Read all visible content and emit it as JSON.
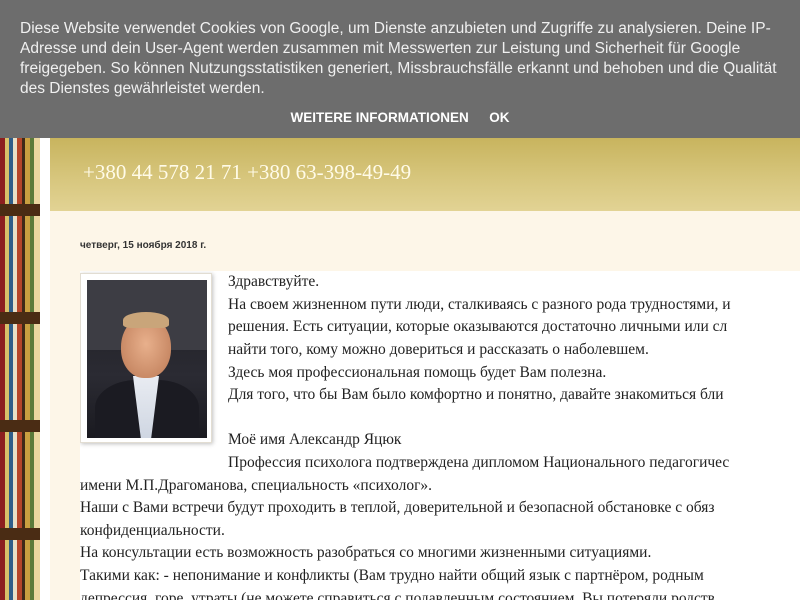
{
  "cookie_banner": {
    "message": "Diese Website verwendet Cookies von Google, um Dienste anzubieten und Zugriffe zu analysieren. Deine IP-Adresse und dein User-Agent werden zusammen mit Messwerten zur Leistung und Sicherheit für Google freigegeben. So können Nutzungsstatistiken generiert, Missbrauchsfälle erkannt und behoben und die Qualität des Dienstes gewährleistet werden.",
    "more_info_label": "WEITERE INFORMATIONEN",
    "ok_label": "OK"
  },
  "header": {
    "phone": "+380 44 578 21 71 +380 63-398-49-49"
  },
  "post": {
    "date": "четверг, 15 ноября 2018 г.",
    "lines": [
      "Здравствуйте.",
      "На своем жизненном пути люди, сталкиваясь с разного рода трудностями, и",
      "решения. Есть ситуации, которые оказываются достаточно личными или сл",
      "найти того, кому можно довериться и рассказать о наболевшем.",
      "Здесь моя профессиональная помощь будет Вам полезна.",
      "Для того, что бы Вам было комфортно и понятно, давайте знакомиться бли",
      "",
      "Моё имя Александр Яцюк",
      "Профессия психолога подтверждена дипломом Национального педагогичес",
      "имени М.П.Драгоманова, специальность «психолог».",
      "Наши с Вами встречи будут проходить в теплой, доверительной и безопасной обстановке с обяз",
      "конфиденциальности.",
      "На консультации есть возможность разобраться со многими жизненными ситуациями.",
      "Такими как: - непонимание и конфликты (Вам трудно найти общий язык с партнёром, родным",
      "депрессия, горе, утраты (не можете справиться с подавленным состоянием. Вы потеряли родств"
    ]
  }
}
